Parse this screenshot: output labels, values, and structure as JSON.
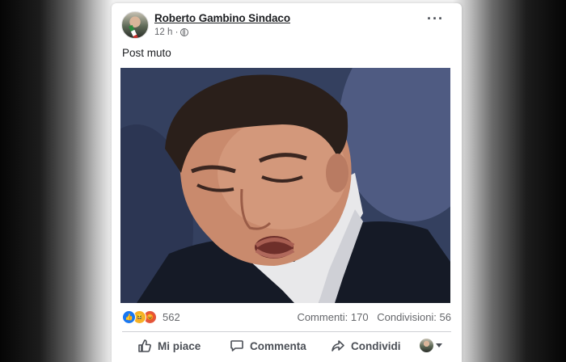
{
  "post": {
    "author": "Roberto Gambino Sindaco",
    "time": "12 h ·",
    "text": "Post muto",
    "photo_alt": ""
  },
  "stats": {
    "reaction_count": "562",
    "comments": "Commenti: 170",
    "shares": "Condivisioni: 56",
    "reactions": [
      "like",
      "haha",
      "angry"
    ]
  },
  "actions": {
    "like": "Mi piace",
    "comment": "Commenta",
    "share": "Condividi"
  },
  "colors": {
    "like_blue": "#1877f2",
    "text_gray": "#65676b",
    "author_black": "#1c1e21"
  }
}
